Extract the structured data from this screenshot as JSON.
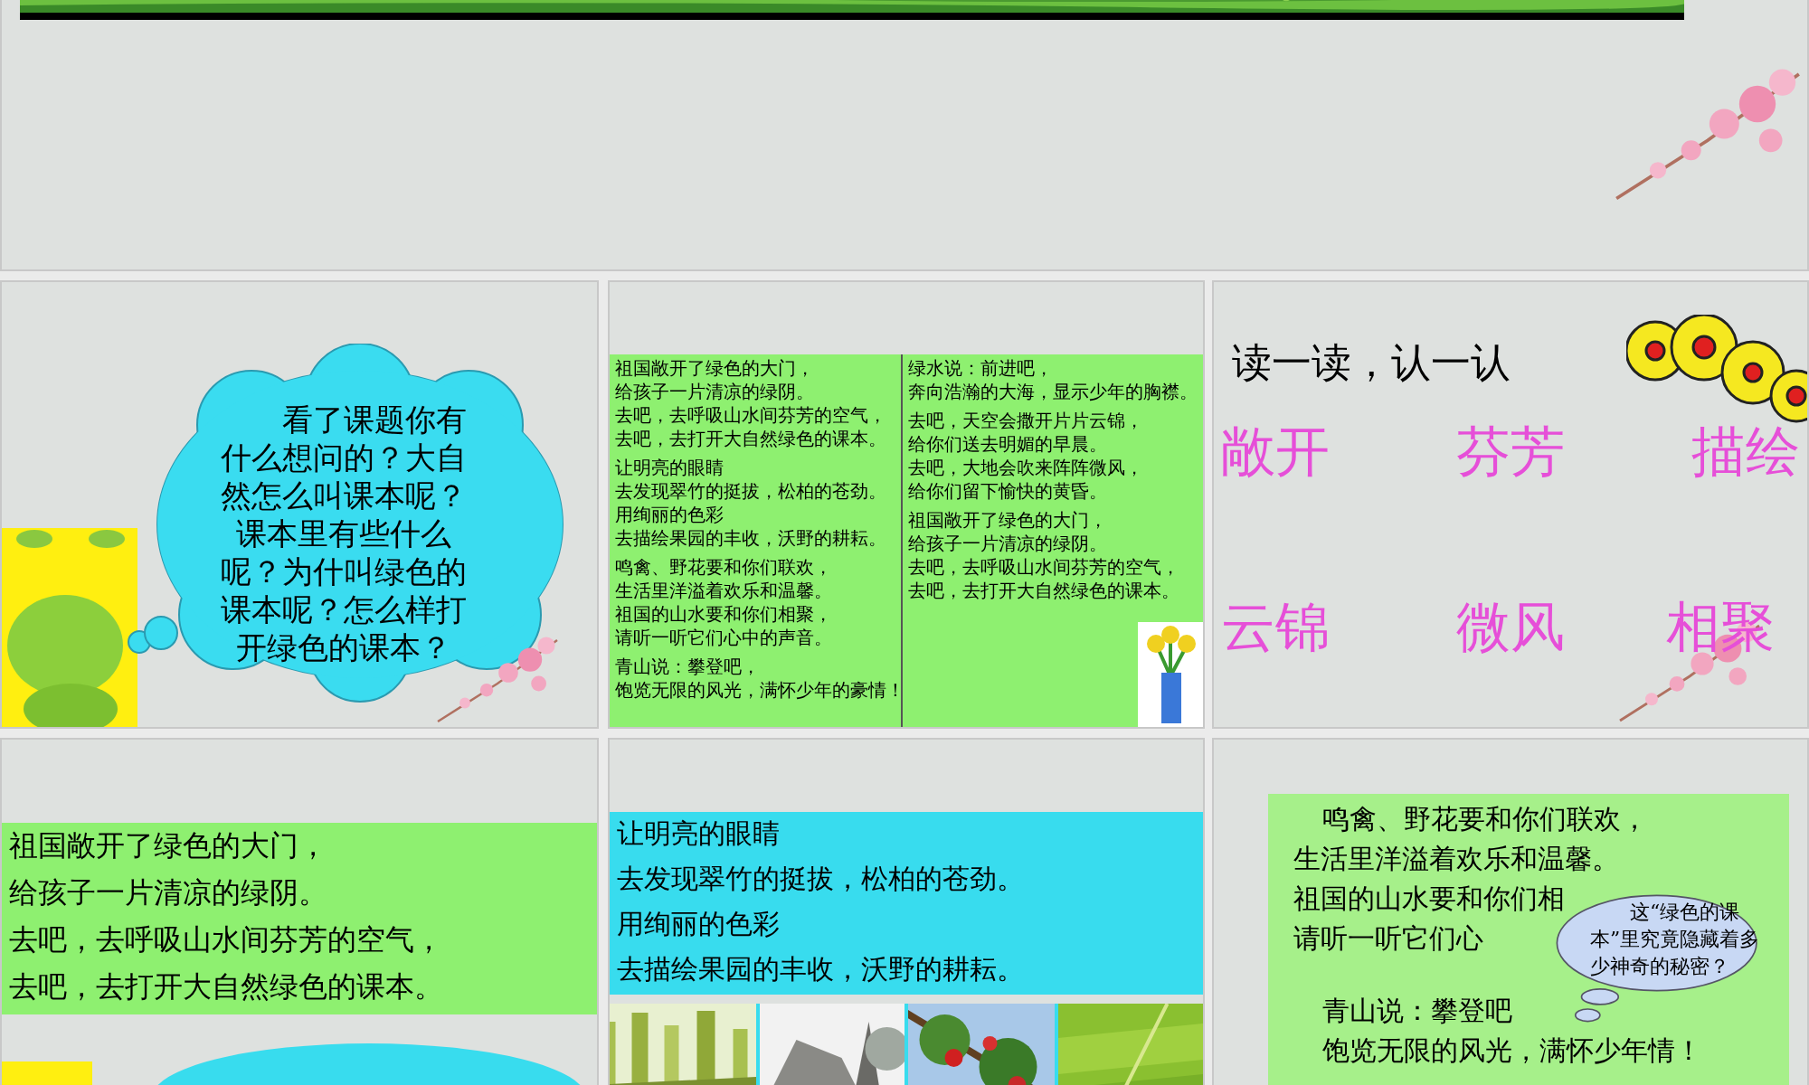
{
  "slides": [
    {
      "kind": "title_banner"
    },
    {
      "kind": "cloud_question",
      "cloud_text": "看了课题你有什么想问的？大自然怎么叫课本呢？课本里有些什么呢？为什叫绿色的课本呢？怎么样打开绿色的课本？"
    },
    {
      "kind": "poem_columns",
      "columns": [
        [
          [
            "祖国敞开了绿色的大门，",
            "给孩子一片清凉的绿阴。",
            "去吧，去呼吸山水间芬芳的空气，",
            "去吧，去打开大自然绿色的课本。"
          ],
          [
            "让明亮的眼睛",
            "去发现翠竹的挺拔，松柏的苍劲。",
            "用绚丽的色彩",
            "去描绘果园的丰收，沃野的耕耘。"
          ],
          [
            "鸣禽、野花要和你们联欢，",
            "生活里洋溢着欢乐和温馨。",
            "祖国的山水要和你们相聚，",
            "请听一听它们心中的声音。"
          ],
          [
            "青山说：攀登吧，",
            "饱览无限的风光，满怀少年的豪情！"
          ]
        ],
        [
          [
            "绿水说：前进吧，",
            "奔向浩瀚的大海，显示少年的胸襟。"
          ],
          [
            "去吧，天空会撒开片片云锦，",
            "给你们送去明媚的早晨。",
            "去吧，大地会吹来阵阵微风，",
            "给你们留下愉快的黄昏。"
          ],
          [
            "祖国敞开了绿色的大门，",
            "给孩子一片清凉的绿阴。",
            "去吧，去呼吸山水间芬芳的空气，",
            "去吧，去打开大自然绿色的课本。"
          ]
        ]
      ]
    },
    {
      "kind": "word_cards",
      "heading": "读一读，认一认",
      "words": [
        "敞开",
        "芬芳",
        "描绘",
        "云锦",
        "微风",
        "相聚"
      ]
    },
    {
      "kind": "stanza_green",
      "lines": [
        "祖国敞开了绿色的大门，",
        "给孩子一片清凉的绿阴。",
        "去吧，去呼吸山水间芬芳的空气，",
        "去吧，去打开大自然绿色的课本。"
      ]
    },
    {
      "kind": "stanza_cyan",
      "lines": [
        "让明亮的眼睛",
        "去发现翠竹的挺拔，松柏的苍劲。",
        "用绚丽的色彩",
        "去描绘果园的丰收，沃野的耕耘。"
      ]
    },
    {
      "kind": "stanza_callout",
      "lines": [
        "鸣禽、野花要和你们联欢，",
        "生活里洋溢着欢乐和温馨。",
        "祖国的山水要和你们相",
        "请听一听它们心",
        "青山说：攀登吧",
        "饱览无限的风光，满怀少年情！"
      ],
      "callout": "这“绿色的课本”里究竟隐藏着多少神奇的秘密？"
    }
  ]
}
